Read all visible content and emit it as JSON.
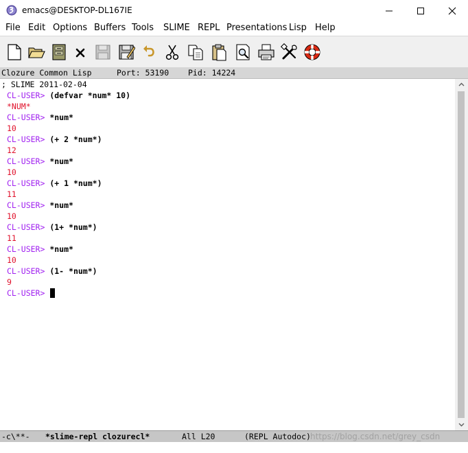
{
  "window": {
    "title": "emacs@DESKTOP-DL167IE",
    "controls": [
      "minimize",
      "maximize",
      "close"
    ]
  },
  "menu": [
    "File",
    "Edit",
    "Options",
    "Buffers",
    "Tools",
    "SLIME",
    "REPL",
    "Presentations",
    "Lisp",
    "Help"
  ],
  "toolbar": {
    "tools": [
      "new-file-icon",
      "open-folder-icon",
      "dired-icon",
      "close-buffer-icon",
      "save-icon",
      "save-as-icon",
      "undo-icon",
      "cut-icon",
      "copy-icon",
      "paste-icon",
      "search-icon",
      "print-icon",
      "preferences-icon",
      "help-icon"
    ]
  },
  "header_line": {
    "impl": "Clozure Common Lisp",
    "port": "Port: 53190",
    "pid": "Pid: 14224"
  },
  "repl": {
    "banner": "; SLIME 2011-02-04",
    "prompt": "CL-USER>",
    "exchanges": [
      {
        "input": "(defvar *num* 10)",
        "output": "*NUM*"
      },
      {
        "input": "*num*",
        "output": "10"
      },
      {
        "input": "(+ 2 *num*)",
        "output": "12"
      },
      {
        "input": "*num*",
        "output": "10"
      },
      {
        "input": "(+ 1 *num*)",
        "output": "11"
      },
      {
        "input": "*num*",
        "output": "10"
      },
      {
        "input": "(1+ *num*)",
        "output": "11"
      },
      {
        "input": "*num*",
        "output": "10"
      },
      {
        "input": "(1- *num*)",
        "output": "9"
      }
    ]
  },
  "mode_line": {
    "status": "-c\\**-",
    "buffer": "*slime-repl clozurecl*",
    "position": "All L20",
    "modes": "(REPL Autodoc)"
  },
  "watermark": "https://blog.csdn.net/grey_csdn",
  "colors": {
    "prompt": "#a020f0",
    "output": "#e0102a",
    "toolbar_bg": "#f0f0f0",
    "header_bg": "#d6d6d6",
    "modeline_bg": "#c6c6c6"
  }
}
